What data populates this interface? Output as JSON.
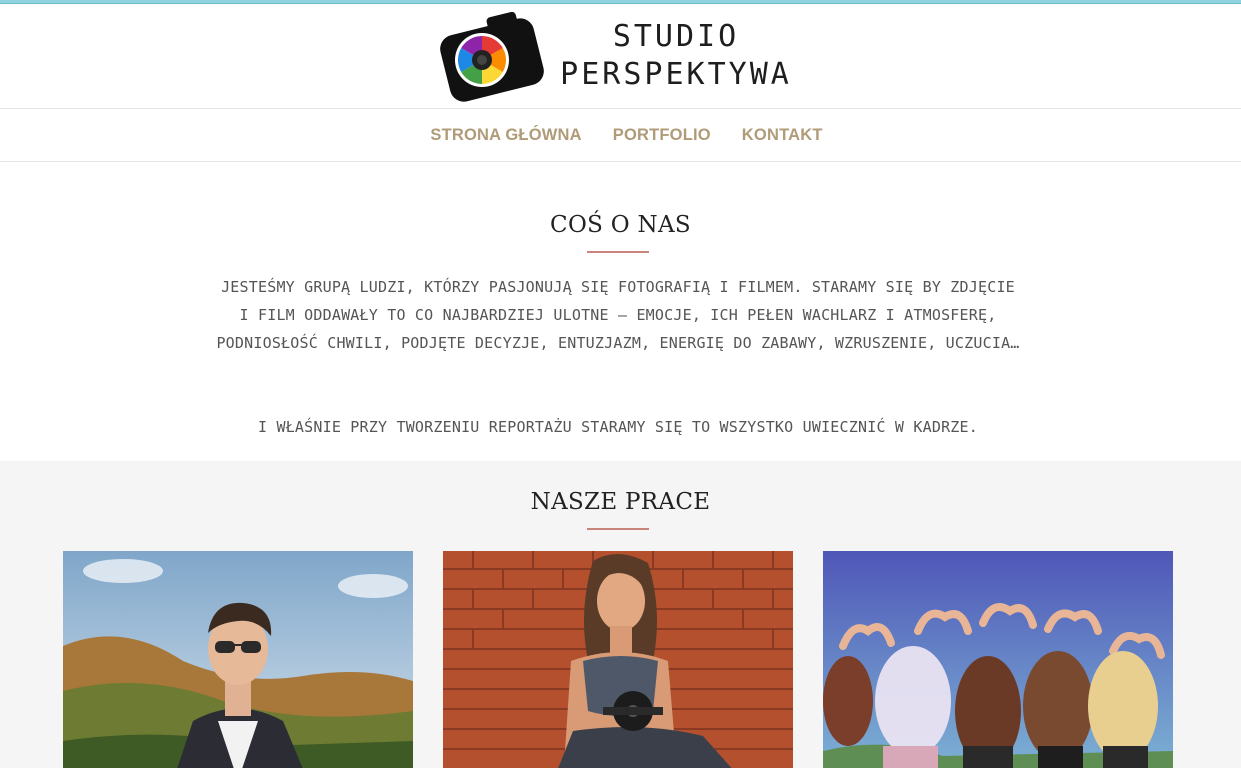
{
  "brand": {
    "line1": "STUDIO",
    "line2": "PERSPEKTYWA",
    "logo_icon": "camera-icon"
  },
  "nav": {
    "items": [
      {
        "label": "STRONA GŁÓWNA"
      },
      {
        "label": "PORTFOLIO"
      },
      {
        "label": "KONTAKT"
      }
    ]
  },
  "about": {
    "title": "COŚ O NAS",
    "paragraph": "JESTEŚMY GRUPĄ LUDZI, KTÓRZY PASJONUJĄ SIĘ FOTOGRAFIĄ I FILMEM. STARAMY SIĘ BY ZDJĘCIE I FILM ODDAWAŁY TO CO NAJBARDZIEJ ULOTNE – EMOCJE, ICH PEŁEN WACHLARZ I ATMOSFERĘ, PODNIOSŁOŚĆ CHWILI, PODJĘTE DECYZJE, ENTUZJAZM, ENERGIĘ DO ZABAWY, WZRUSZENIE, UCZUCIA…",
    "paragraph2": "I WŁAŚNIE PRZY TWORZENIU REPORTAŻU STARAMY SIĘ TO WSZYSTKO UWIECZNIĆ W KADRZE."
  },
  "works": {
    "title": "NASZE PRACE"
  },
  "colors": {
    "accent_top": "#8fd3e0",
    "nav_text": "#b09b78",
    "underline": "#c9857c",
    "works_bg": "#f5f5f5"
  }
}
